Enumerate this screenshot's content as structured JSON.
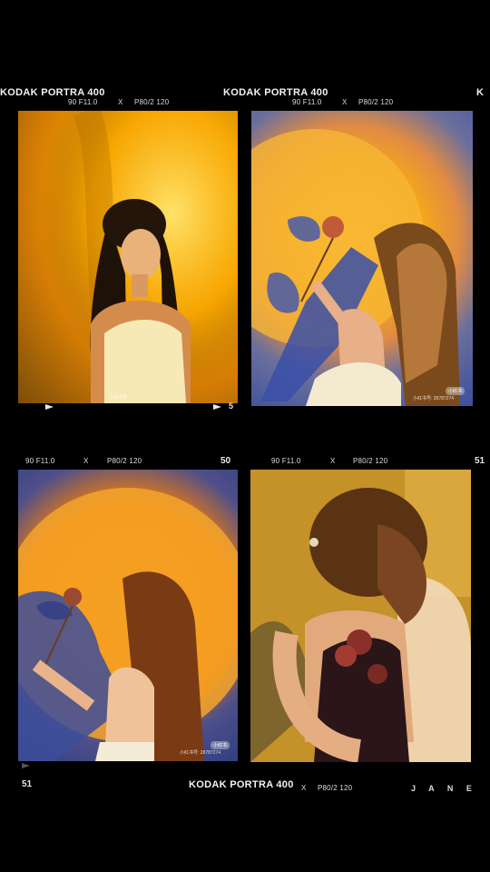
{
  "strip": {
    "title": "KODAK PORTRA 400",
    "exposure": "90 F11.0",
    "cross": "X",
    "lens": "P80/2 120",
    "brand_tail": "KODAK PORTRA 400",
    "partial_k": "K",
    "frame_5": "5",
    "frame_50": "50",
    "frame_51": "51",
    "author": "J A N E"
  },
  "photos": [
    {
      "scene": "Woman with long dark hair in white camisole against golden sunset lamp glow",
      "watermark": "小红书号"
    },
    {
      "scene": "Woman holding dried rose with hand shadow on sunset-lamp lit wall",
      "watermark": "小红书号: 28787274",
      "badge": "小红书"
    },
    {
      "scene": "Woman in profile raising dried flower, orange circular light and blue shadow",
      "watermark": "小红书号: 28787274",
      "badge": "小红书"
    },
    {
      "scene": "Woman with hair clip wearing dark camisole holding roses in warm room",
      "watermark": ""
    }
  ],
  "colors": {
    "background": "#000000",
    "text": "#f2f2f2"
  }
}
